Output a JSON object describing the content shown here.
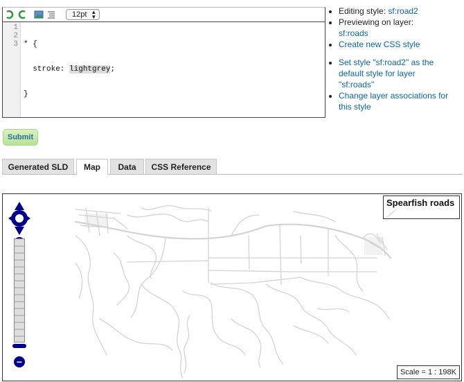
{
  "editor": {
    "font_size": "12pt",
    "line_numbers": [
      "1",
      "2",
      "3"
    ],
    "code": {
      "line1": "* {",
      "line2_prefix": "  stroke: ",
      "line2_value": "lightgrey",
      "line2_suffix": ";",
      "line3": "}"
    }
  },
  "info": {
    "editing_label": "Editing style: ",
    "editing_value": "sf:road2",
    "preview_label": "Previewing on layer:",
    "preview_value": "sf:roads",
    "create_link": "Create new CSS style",
    "default_link": "Set style \"sf:road2\" as the default style for layer \"sf:roads\"",
    "change_link": "Change layer associations for this style"
  },
  "submit_label": "Submit",
  "tabs": [
    "Generated SLD",
    "Map",
    "Data",
    "CSS Reference"
  ],
  "active_tab": "Map",
  "map": {
    "legend_title": "Spearfish roads",
    "scale_text": "Scale = 1 : 198K",
    "road_color": "#d3d3d3"
  }
}
